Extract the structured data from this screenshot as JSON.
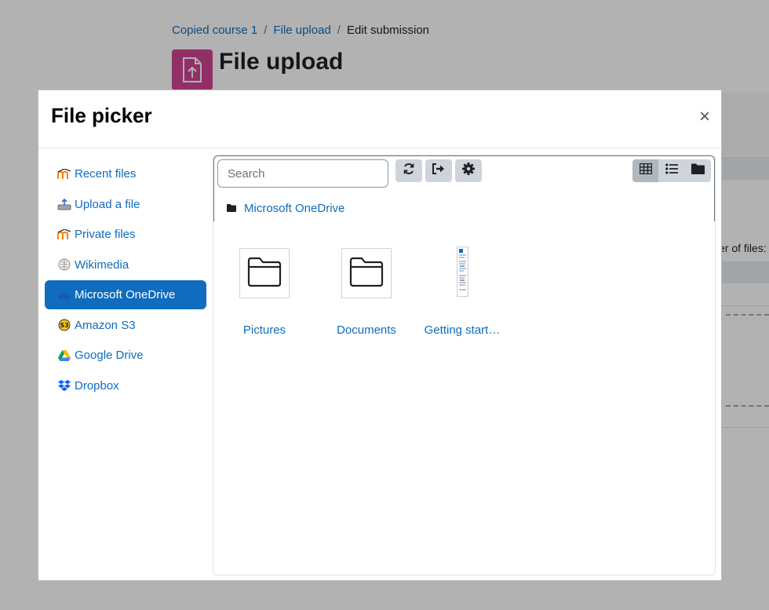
{
  "background": {
    "breadcrumb": [
      "Copied course 1",
      "File upload",
      "Edit submission"
    ],
    "breadcrumb_sep": "/",
    "heading": "File upload",
    "max_files_text": "er of files:"
  },
  "modal": {
    "title": "File picker",
    "close_label": "×"
  },
  "sidebar": {
    "items": [
      {
        "label": "Recent files",
        "icon": "moodle-icon"
      },
      {
        "label": "Upload a file",
        "icon": "upload-icon"
      },
      {
        "label": "Private files",
        "icon": "moodle-icon"
      },
      {
        "label": "Wikimedia",
        "icon": "wikimedia-icon"
      },
      {
        "label": "Microsoft OneDrive",
        "icon": "onedrive-icon",
        "active": true
      },
      {
        "label": "Amazon S3",
        "icon": "s3-icon"
      },
      {
        "label": "Google Drive",
        "icon": "google-drive-icon"
      },
      {
        "label": "Dropbox",
        "icon": "dropbox-icon"
      }
    ]
  },
  "toolbar": {
    "search_placeholder": "Search",
    "buttons": [
      "refresh-icon",
      "logout-icon",
      "gear-icon"
    ],
    "views": [
      "grid-view-icon",
      "list-view-icon",
      "folder-view-icon"
    ],
    "active_view": 0
  },
  "path": {
    "current": "Microsoft OneDrive"
  },
  "files": [
    {
      "name": "Pictures",
      "type": "folder"
    },
    {
      "name": "Documents",
      "type": "folder"
    },
    {
      "name": "Getting start…",
      "type": "document"
    }
  ],
  "colors": {
    "link": "#0f6cbf",
    "active_bg": "#0f6cbf",
    "activity_icon_bg": "#d04693",
    "button_bg": "#ced4da"
  }
}
